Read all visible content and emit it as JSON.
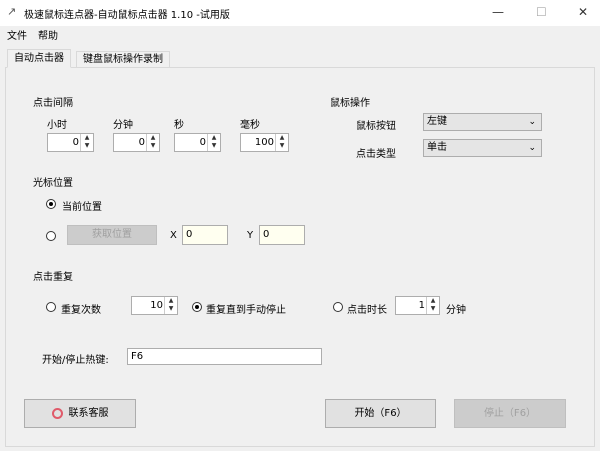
{
  "window": {
    "title": "极速鼠标连点器-自动鼠标点击器 1.10  -试用版",
    "min": "—",
    "max": "☐",
    "close": "✕"
  },
  "menu": [
    "文件",
    "帮助"
  ],
  "tabs": [
    "自动点击器",
    "键盘鼠标操作录制"
  ],
  "interval": {
    "title": "点击间隔",
    "fields": [
      {
        "label": "小时",
        "value": "0"
      },
      {
        "label": "分钟",
        "value": "0"
      },
      {
        "label": "秒",
        "value": "0"
      },
      {
        "label": "毫秒",
        "value": "100"
      }
    ]
  },
  "mouse": {
    "title": "鼠标操作",
    "button_label": "鼠标按钮",
    "button_value": "左键",
    "type_label": "点击类型",
    "type_value": "单击"
  },
  "cursor": {
    "title": "光标位置",
    "current": "当前位置",
    "get_button": "获取位置",
    "x_label": "X",
    "x_value": "0",
    "y_label": "Y",
    "y_value": "0"
  },
  "repeat": {
    "title": "点击重复",
    "count_label": "重复次数",
    "count_value": "10",
    "until_label": "重复直到手动停止",
    "duration_label": "点击时长",
    "duration_value": "1",
    "duration_unit": "分钟"
  },
  "hotkey": {
    "label": "开始/停止热键:",
    "value": "F6"
  },
  "buttons": {
    "support": "联系客服",
    "start": "开始（F6）",
    "stop": "停止（F6）"
  }
}
